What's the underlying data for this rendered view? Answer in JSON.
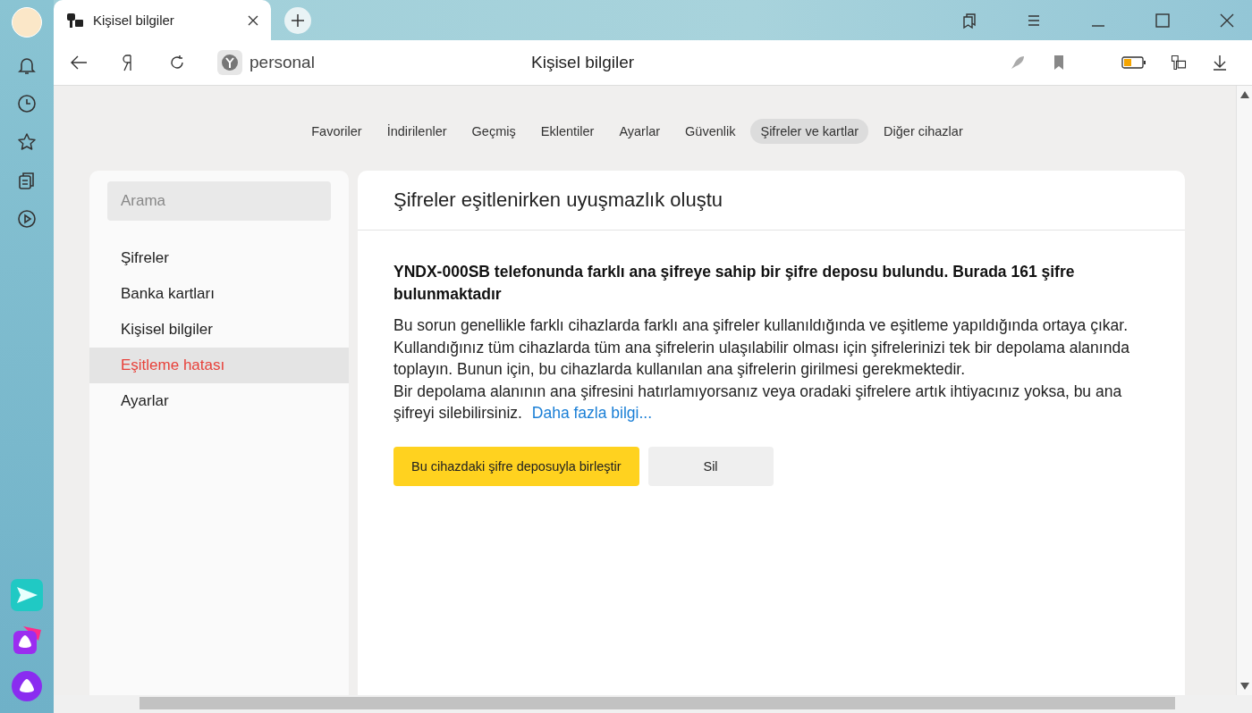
{
  "browser_tab": {
    "title": "Kişisel bilgiler"
  },
  "address": {
    "text": "personal"
  },
  "page_title": "Kişisel bilgiler",
  "nav_tabs": [
    {
      "label": "Favoriler",
      "selected": false
    },
    {
      "label": "İndirilenler",
      "selected": false
    },
    {
      "label": "Geçmiş",
      "selected": false
    },
    {
      "label": "Eklentiler",
      "selected": false
    },
    {
      "label": "Ayarlar",
      "selected": false
    },
    {
      "label": "Güvenlik",
      "selected": false
    },
    {
      "label": "Şifreler ve kartlar",
      "selected": true
    },
    {
      "label": "Diğer cihazlar",
      "selected": false
    }
  ],
  "search": {
    "placeholder": "Arama"
  },
  "menu": [
    {
      "label": "Şifreler",
      "selected": false
    },
    {
      "label": "Banka kartları",
      "selected": false
    },
    {
      "label": "Kişisel bilgiler",
      "selected": false
    },
    {
      "label": "Eşitleme hatası",
      "selected": true
    },
    {
      "label": "Ayarlar",
      "selected": false
    }
  ],
  "panel": {
    "title": "Şifreler eşitlenirken uyuşmazlık oluştu",
    "heading": "YNDX-000SB telefonunda farklı ana şifreye sahip bir şifre deposu bulundu. Burada 161 şifre bulunmaktadır",
    "paragraphs": [
      "Bu sorun genellikle farklı cihazlarda farklı ana şifreler kullanıldığında ve eşitleme yapıldığında ortaya çıkar.",
      "Kullandığınız tüm cihazlarda tüm ana şifrelerin ulaşılabilir olması için şifrelerinizi tek bir depolama alanında toplayın. Bunun için, bu cihazlarda kullanılan ana şifrelerin girilmesi gerekmektedir.",
      "Bir depolama alanının ana şifresini hatırlamıyorsanız veya oradaki şifrelere artık ihtiyacınız yoksa, bu ana şifreyi silebilirsiniz."
    ],
    "link": "Daha fazla bilgi...",
    "buttons": [
      {
        "label": "Bu cihazdaki şifre deposuyla birleştir",
        "kind": "primary"
      },
      {
        "label": "Sil",
        "kind": "secondary"
      }
    ]
  }
}
